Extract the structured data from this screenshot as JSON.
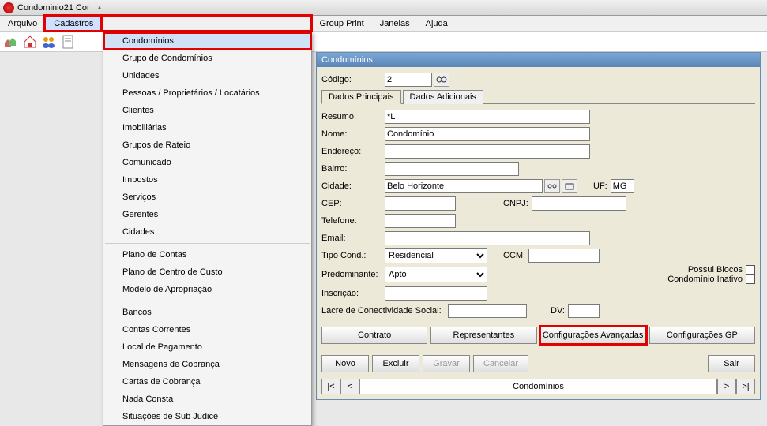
{
  "title": "Condominio21 Cor",
  "menus": {
    "arquivo": "Arquivo",
    "cadastros": "Cadastros",
    "group_print": "Group Print",
    "janelas": "Janelas",
    "ajuda": "Ajuda"
  },
  "dropdown": {
    "items": [
      "Condomínios",
      "Grupo de Condomínios",
      "Unidades",
      "Pessoas / Proprietários / Locatários",
      "Clientes",
      "Imobiliárias",
      "Grupos de Rateio",
      "Comunicado",
      "Impostos",
      "Serviços",
      "Gerentes",
      "Cidades",
      "Plano de Contas",
      "Plano de Centro de Custo",
      "Modelo de Apropriação",
      "Bancos",
      "Contas Correntes",
      "Local de Pagamento",
      "Mensagens de Cobrança",
      "Cartas de Cobrança",
      "Nada Consta",
      "Situações de Sub Judice"
    ]
  },
  "panel": {
    "title": "Condomínios",
    "codigo_label": "Código:",
    "codigo_value": "2",
    "tab_principal": "Dados Principais",
    "tab_adicionais": "Dados Adicionais",
    "resumo_label": "Resumo:",
    "resumo_value": "*L",
    "nome_label": "Nome:",
    "nome_value": "Condomínio",
    "endereco_label": "Endereço:",
    "endereco_value": "",
    "bairro_label": "Bairro:",
    "bairro_value": "",
    "cidade_label": "Cidade:",
    "cidade_value": "Belo Horizonte",
    "uf_label": "UF:",
    "uf_value": "MG",
    "cep_label": "CEP:",
    "cep_value": "",
    "cnpj_label": "CNPJ:",
    "cnpj_value": "",
    "telefone_label": "Telefone:",
    "telefone_value": "",
    "email_label": "Email:",
    "email_value": "",
    "tipo_label": "Tipo Cond.:",
    "tipo_value": "Residencial",
    "ccm_label": "CCM:",
    "ccm_value": "",
    "predominante_label": "Predominante:",
    "predominante_value": "Apto",
    "inscricao_label": "Inscrição:",
    "inscricao_value": "",
    "lacre_label": "Lacre de Conectividade Social:",
    "lacre_value": "",
    "dv_label": "DV:",
    "dv_value": "",
    "possui_blocos": "Possui Blocos",
    "inativo": "Condomínio Inativo",
    "btn_contrato": "Contrato",
    "btn_representantes": "Representantes",
    "btn_config_av": "Configurações Avançadas",
    "btn_config_gp": "Configurações GP",
    "btn_novo": "Novo",
    "btn_excluir": "Excluir",
    "btn_gravar": "Gravar",
    "btn_cancelar": "Cancelar",
    "btn_sair": "Sair",
    "nav_center": "Condomínios",
    "nav_first": "|<",
    "nav_prev": "<",
    "nav_next": ">",
    "nav_last": ">|"
  }
}
